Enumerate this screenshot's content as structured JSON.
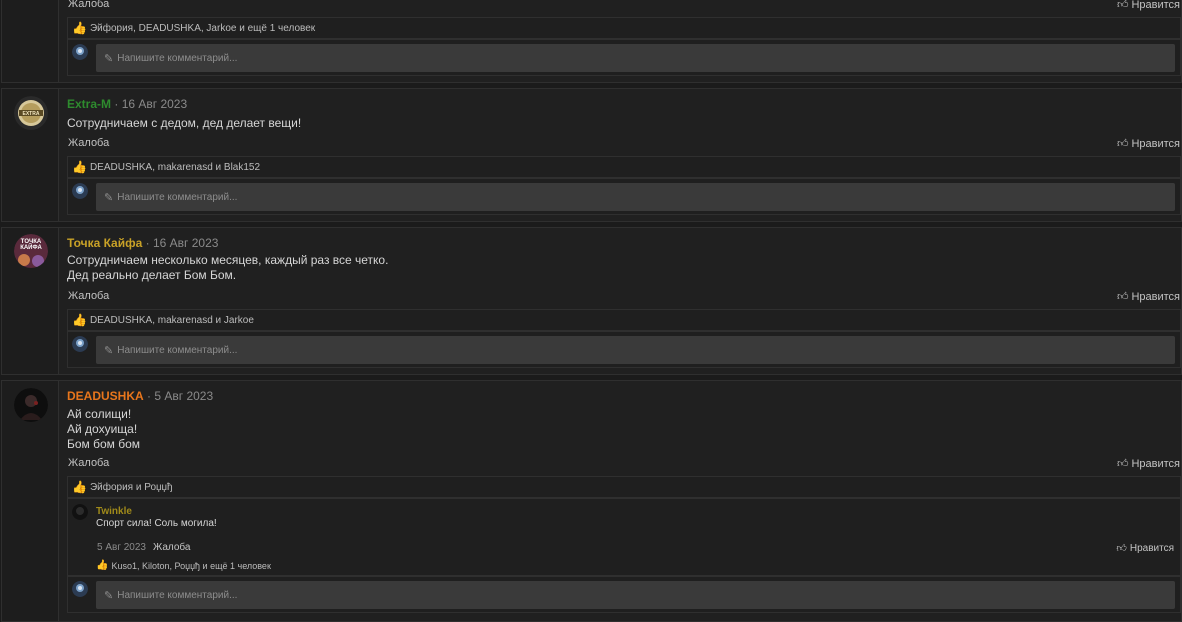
{
  "common": {
    "report_label": "Жалоба",
    "like_label": "Нравится",
    "comment_placeholder": "Напишите комментарий..."
  },
  "top_partial": {
    "report_label": "Жалоба",
    "like_label": "Нравится",
    "reactions": "Эйфория, DEADUSHKA, Jarkoe и ещё 1 человек"
  },
  "posts": [
    {
      "username": "Extra-M",
      "username_color": "#2e8b2e",
      "date": "· 16 Авг 2023",
      "lines": [
        "Сотрудничаем с дедом, дед делает вещи!"
      ],
      "reactions": "DEADUSHKA, makarenasd и Blak152",
      "avatar_icon": "extra-logo-avatar"
    },
    {
      "username": "Точка Кайфа",
      "username_color": "#c9a227",
      "date": "· 16 Авг 2023",
      "lines": [
        "Сотрудничаем несколько месяцев, каждый раз все четко.",
        "Дед реально делает Бом Бом."
      ],
      "reactions": "DEADUSHKA, makarenasd и Jarkoe",
      "avatar_icon": "tochka-kaifa-avatar",
      "avatar_text": "ТОЧКА КАЙФА"
    },
    {
      "username": "DEADUSHKA",
      "username_color": "#e8761c",
      "date": "· 5 Авг 2023",
      "lines": [
        "Ай солищи!",
        "Ай дохуища!",
        "Бом бом бом"
      ],
      "reactions": "Эйфория и Роџџђ",
      "avatar_icon": "dark-figure-avatar",
      "reply": {
        "username": "Twinkle",
        "username_color": "#a08a1a",
        "text": "Спорт сила! Соль могила!",
        "date": "5 Авг 2023",
        "report_label": "Жалоба",
        "like_label": "Нравится",
        "reactions": "Kuso1, Kiloton, Роџџђ и ещё 1 человек"
      }
    }
  ],
  "colors": {
    "background": "#1b1b1b",
    "panel": "#202020",
    "input": "#3a3a3a",
    "reaction_thumb": "#e9b84a"
  }
}
